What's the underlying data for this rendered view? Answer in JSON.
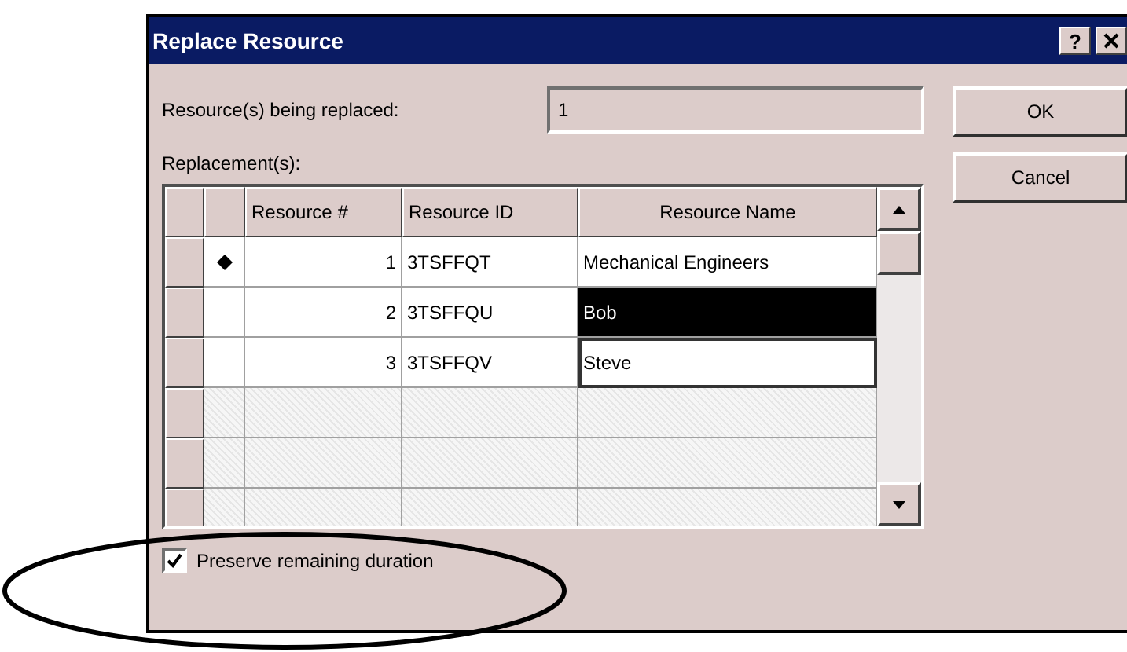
{
  "window": {
    "title": "Replace Resource",
    "help_button": "?"
  },
  "being_replaced": {
    "label": "Resource(s) being replaced:",
    "value": "1"
  },
  "buttons": [
    "OK",
    "Cancel"
  ],
  "replacements": {
    "label": "Replacement(s):",
    "columns": [
      "Resource #",
      "Resource ID",
      "Resource Name"
    ],
    "rows": [
      {
        "number": "1",
        "id": "3TSFFQT",
        "name": "Mechanical Engineers",
        "current": true,
        "selected": false,
        "focused": false
      },
      {
        "number": "2",
        "id": "3TSFFQU",
        "name": "Bob",
        "current": false,
        "selected": true,
        "focused": false
      },
      {
        "number": "3",
        "id": "3TSFFQV",
        "name": "Steve",
        "current": false,
        "selected": false,
        "focused": true
      }
    ]
  },
  "preserve_duration": {
    "label": "Preserve remaining duration",
    "checked": true
  }
}
